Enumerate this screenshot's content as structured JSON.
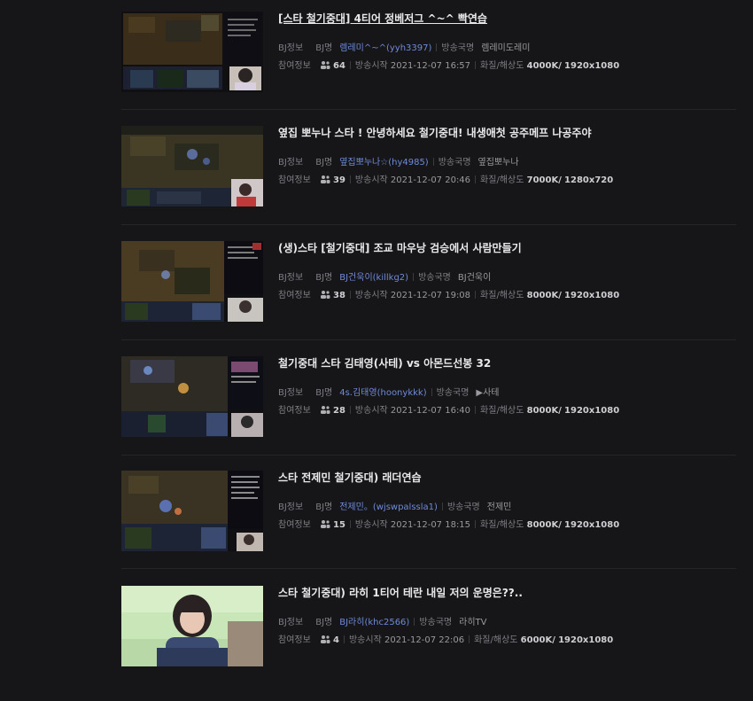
{
  "labels": {
    "bj_info": "BJ정보",
    "bj_name": "BJ명",
    "broadcast_country": "방송국명",
    "participation_info": "참여정보",
    "start_time": "방송시작",
    "quality": "화질/해상도"
  },
  "items": [
    {
      "title": "[스타 철기중대] 4티어 정베저그 ^~^ 빡연습",
      "bj_name": "렘레미^~^(yyh3397)",
      "station": "렘레미도레미",
      "viewers": "64",
      "start": "2021-12-07 16:57",
      "bitrate": "4000K/",
      "resolution": "1920x1080"
    },
    {
      "title": "옆집 뽀누나 스타 ! 안녕하세요 철기중대! 내생애첫 공주메프 나공주야",
      "bj_name": "옆집뽀누나☆(hy4985)",
      "station": "옆집뽀누나",
      "viewers": "39",
      "start": "2021-12-07 20:46",
      "bitrate": "7000K/",
      "resolution": "1280x720"
    },
    {
      "title": "(생)스타 [철기중대] 조교 마우낭 검승에서 사람만들기",
      "bj_name": "BJ건욱이(killkg2)",
      "station": "BJ건욱이",
      "viewers": "38",
      "start": "2021-12-07 19:08",
      "bitrate": "8000K/",
      "resolution": "1920x1080"
    },
    {
      "title": "철기중대 스타 김태영(사테) vs 아몬드선봉 32",
      "bj_name": "4s.김태영(hoonykkk)",
      "station": "▶사테",
      "viewers": "28",
      "start": "2021-12-07 16:40",
      "bitrate": "8000K/",
      "resolution": "1920x1080"
    },
    {
      "title": "스타 전제민 철기중대) 래더연습",
      "bj_name": "전제민。(wjswpalssla1)",
      "station": "전제민",
      "viewers": "15",
      "start": "2021-12-07 18:15",
      "bitrate": "8000K/",
      "resolution": "1920x1080"
    },
    {
      "title": "스타 철기중대) 라히 1티어 테란 내일 저의 운명은??..",
      "bj_name": "BJ라히(khc2566)",
      "station": "라히TV",
      "viewers": "4",
      "start": "2021-12-07 22:06",
      "bitrate": "6000K/",
      "resolution": "1920x1080"
    }
  ],
  "colors": {
    "background": "#161618",
    "title": "#e9e9ec",
    "link": "#6f8ad9",
    "divider": "#26262a"
  }
}
